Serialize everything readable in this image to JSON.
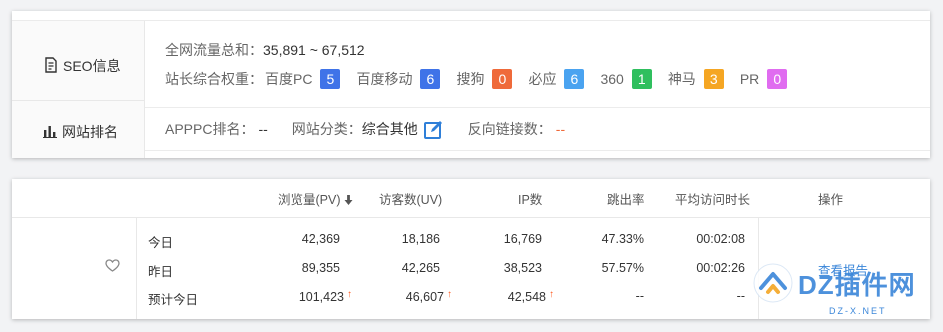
{
  "seo": {
    "section_label": "SEO信息",
    "traffic_label": "全网流量总和：",
    "traffic_value": "35,891 ~ 67,512",
    "weight_label": "站长综合权重：",
    "weights": [
      {
        "name": "百度PC",
        "value": "5",
        "color": "#3f73e8"
      },
      {
        "name": "百度移动",
        "value": "6",
        "color": "#3f73e8"
      },
      {
        "name": "搜狗",
        "value": "0",
        "color": "#ef6a3a"
      },
      {
        "name": "必应",
        "value": "6",
        "color": "#4aa3f0"
      },
      {
        "name": "360",
        "value": "1",
        "color": "#2fbf5e"
      },
      {
        "name": "神马",
        "value": "3",
        "color": "#f5a623"
      },
      {
        "name": "PR",
        "value": "0",
        "color": "#e06cf0"
      }
    ]
  },
  "ranking": {
    "section_label": "网站排名",
    "apppc_label": "APPPC排名：",
    "apppc_value": "--",
    "category_label": "网站分类：",
    "category_value": "综合其他",
    "backlinks_label": "反向链接数：",
    "backlinks_value": "--"
  },
  "stats": {
    "headers": {
      "pv": "浏览量(PV)",
      "uv": "访客数(UV)",
      "ip": "IP数",
      "bounce": "跳出率",
      "avg_time": "平均访问时长",
      "action": "操作"
    },
    "rows": [
      {
        "label": "今日",
        "pv": "42,369",
        "uv": "18,186",
        "ip": "16,769",
        "bounce": "47.33%",
        "avg_time": "00:02:08"
      },
      {
        "label": "昨日",
        "pv": "89,355",
        "uv": "42,265",
        "ip": "38,523",
        "bounce": "57.57%",
        "avg_time": "00:02:26"
      },
      {
        "label": "预计今日",
        "pv": "101,423",
        "uv": "46,607",
        "ip": "42,548",
        "bounce": "--",
        "avg_time": "--"
      }
    ],
    "report_link": "查看报告"
  },
  "watermark": {
    "text": "DZ插件网",
    "sub": "DZ-X.NET"
  }
}
